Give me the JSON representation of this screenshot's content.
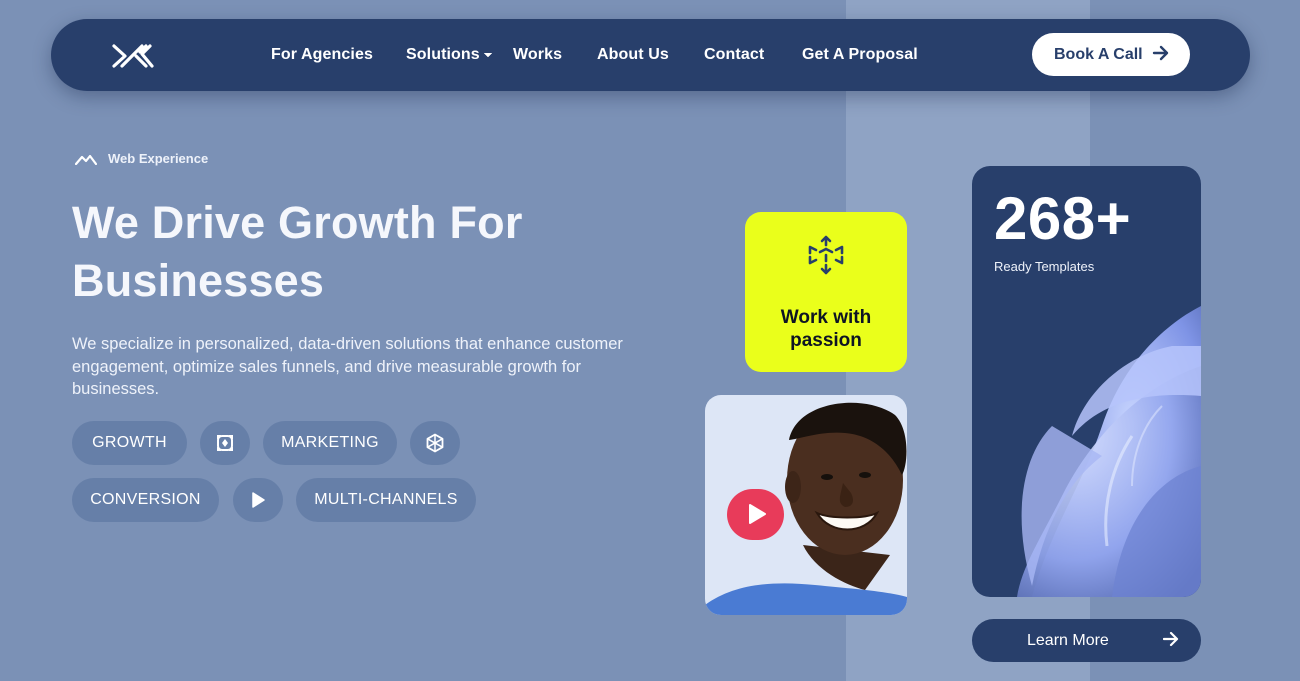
{
  "nav": {
    "items": [
      {
        "label": "For Agencies"
      },
      {
        "label": "Solutions"
      },
      {
        "label": "Works"
      },
      {
        "label": "About Us"
      },
      {
        "label": "Contact"
      },
      {
        "label": "Get A Proposal"
      }
    ],
    "cta_label": "Book A Call",
    "logo_icon": "logo-mark-icon"
  },
  "hero": {
    "eyebrow": "Web Experience",
    "headline_line1": "We Drive Growth For",
    "headline_line2": "Businesses",
    "subtext": "We specialize in personalized, data-driven solutions that enhance customer engagement, optimize sales funnels, and drive measurable growth for businesses.",
    "tags": [
      {
        "label": "GROWTH"
      },
      {
        "icon": "ai-chip-icon"
      },
      {
        "label": "MARKETING"
      },
      {
        "icon": "hexagon-network-icon"
      },
      {
        "label": "CONVERSION"
      },
      {
        "icon": "play-icon"
      },
      {
        "label": "MULTI-CHANNELS"
      }
    ]
  },
  "passion_card": {
    "text": "Work with passion",
    "icon": "cube-arrows-icon"
  },
  "stat_card": {
    "number": "268+",
    "label": "Ready Templates"
  },
  "learn_more_label": "Learn More",
  "colors": {
    "background": "#7b91b6",
    "navy": "#283f6b",
    "lime": "#eaff1b",
    "play_red": "#e83b5a",
    "pill": "#667fa8"
  }
}
